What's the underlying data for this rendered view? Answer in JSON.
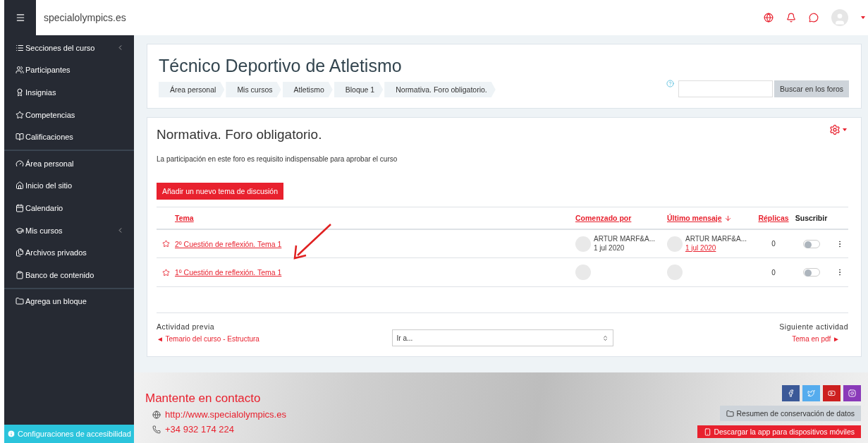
{
  "header": {
    "site_name": "specialolympics.es"
  },
  "sidebar": {
    "groups": [
      {
        "items": [
          {
            "label": "Secciones del curso",
            "expandable": true
          },
          {
            "label": "Participantes",
            "expandable": false
          },
          {
            "label": "Insignias",
            "expandable": false
          },
          {
            "label": "Competencias",
            "expandable": false
          },
          {
            "label": "Calificaciones",
            "expandable": false
          }
        ]
      },
      {
        "items": [
          {
            "label": "Área personal",
            "expandable": false
          },
          {
            "label": "Inicio del sitio",
            "expandable": false
          },
          {
            "label": "Calendario",
            "expandable": false
          },
          {
            "label": "Mis cursos",
            "expandable": true
          },
          {
            "label": "Archivos privados",
            "expandable": false
          },
          {
            "label": "Banco de contenido",
            "expandable": false
          }
        ]
      },
      {
        "items": [
          {
            "label": "Agrega un bloque",
            "expandable": false
          }
        ]
      }
    ],
    "accessibility": "Configuraciones de accesibilidad"
  },
  "course": {
    "title": "Técnico Deportivo de Atletismo",
    "breadcrumbs": [
      {
        "label": "Área personal"
      },
      {
        "label": "Mis cursos"
      },
      {
        "label": "Atletismo"
      },
      {
        "label": "Bloque 1"
      },
      {
        "label": "Normativa. Foro obligatorio."
      }
    ],
    "search_button": "Buscar en los foros"
  },
  "forum": {
    "title": "Normativa. Foro obligatorio.",
    "description": "La participación en este foro es requisito indispensable para aprobar el curso",
    "add_button": "Añadir un nuevo tema de discusión",
    "columns": [
      {
        "label": "Tema",
        "kind": "link",
        "sorted": false
      },
      {
        "label": "Comenzado por",
        "kind": "link",
        "sorted": false
      },
      {
        "label": "Último mensaje",
        "kind": "link",
        "sorted": true
      },
      {
        "label": "Réplicas",
        "kind": "link",
        "sorted": false
      },
      {
        "label": "Suscribir",
        "kind": "plain",
        "sorted": false
      }
    ],
    "discussions": [
      {
        "title": "2º Cuestión de reflexión. Tema 1",
        "starred": false,
        "started_by": {
          "name": "ARTUR MARF&A...",
          "date": "1 jul 2020"
        },
        "last_post": {
          "name": "ARTUR MARF&A...",
          "date": "1 jul 2020"
        },
        "replies": "0",
        "subscribed": false
      },
      {
        "title": "1º Cuestión de reflexión. Tema 1",
        "starred": false,
        "replies": "0",
        "subscribed": false
      }
    ]
  },
  "activity_nav": {
    "previous_label": "Actividad previa",
    "previous_link": "◄ Temario del curso - Estructura",
    "jump_value": "Ir a...",
    "next_label": "Siguiente actividad",
    "next_link": "Tema en pdf ►"
  },
  "footer": {
    "heading": "Mantente en contacto",
    "contacts": [
      {
        "kind": "web",
        "text": "http://www.specialolympics.es"
      },
      {
        "kind": "phone",
        "text": "+34 932 174 224"
      }
    ],
    "social": [
      {
        "kind": "facebook",
        "color": "#3b5998"
      },
      {
        "kind": "twitter",
        "color": "#55acee"
      },
      {
        "kind": "youtube",
        "color": "#cd201f"
      },
      {
        "kind": "instagram",
        "color": "#8a3ab9"
      }
    ],
    "data_button": "Resumen de conservación de datos",
    "app_button": "Descargar la app para dispositivos móviles"
  }
}
